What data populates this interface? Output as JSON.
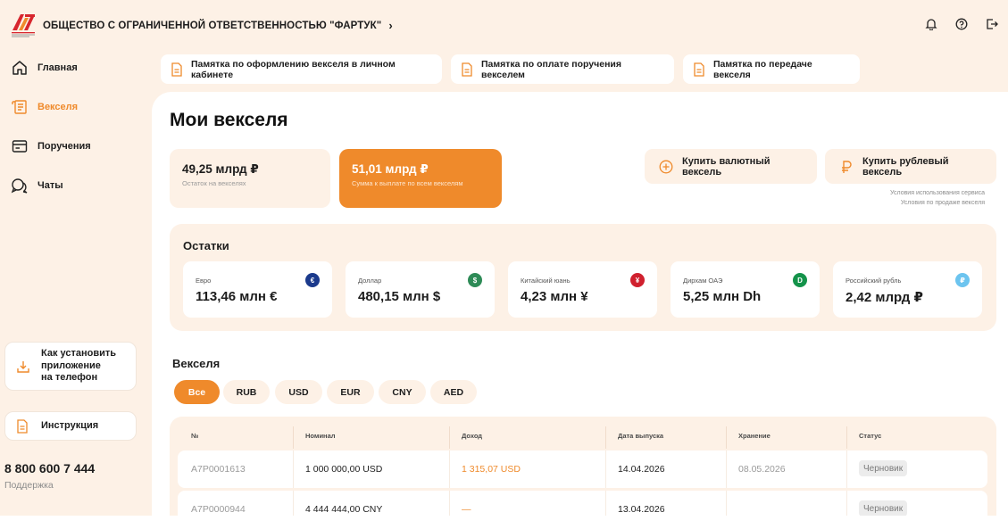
{
  "header": {
    "org_name": "ОБЩЕСТВО С ОГРАНИЧЕННОЙ ОТВЕТСТВЕННОСТЬЮ \"ФАРТУК\"",
    "icons": [
      "bell-icon",
      "help-icon",
      "logout-icon"
    ]
  },
  "sidebar": {
    "items": [
      {
        "label": "Главная",
        "icon": "home-icon",
        "active": false
      },
      {
        "label": "Векселя",
        "icon": "bills-icon",
        "active": true
      },
      {
        "label": "Поручения",
        "icon": "orders-icon",
        "active": false
      },
      {
        "label": "Чаты",
        "icon": "chat-icon",
        "active": false
      }
    ],
    "install_app": "Как установить приложение на телефон",
    "install_lines": [
      "Как установить",
      "приложение",
      "на телефон"
    ],
    "instruction": "Инструкция",
    "phone": "8 800 600 7 444",
    "support": "Поддержка"
  },
  "memos": [
    "Памятка по оформлению векселя в личном кабинете",
    "Памятка по оплате поручения векселем",
    "Памятка по передаче векселя"
  ],
  "main": {
    "title": "Мои векселя",
    "summary": [
      {
        "value": "49,25 млрд ₽",
        "label": "Остаток на векселях"
      },
      {
        "value": "51,01 млрд ₽",
        "label": "Сумма к выплате по всем векселям"
      }
    ],
    "buy_currency": "Купить валютный вексель",
    "buy_rub": "Купить рублевый вексель",
    "terms_link": "Условия использования сервиса",
    "sale_terms_link": "Условия по продаже векселя"
  },
  "balances": {
    "title": "Остатки",
    "items": [
      {
        "name": "Евро",
        "amount": "113,46 млн €",
        "symbol": "€",
        "color": "#1b3a8c"
      },
      {
        "name": "Доллар",
        "amount": "480,15 млн $",
        "symbol": "$",
        "color": "#2e8b57"
      },
      {
        "name": "Китайский юань",
        "amount": "4,23 млн ¥",
        "symbol": "¥",
        "color": "#d0202e"
      },
      {
        "name": "Дирхам ОАЭ",
        "amount": "5,25 млн Dh",
        "symbol": "D",
        "color": "#14934a"
      },
      {
        "name": "Российский рубль",
        "amount": "2,42 млрд ₽",
        "symbol": "₽",
        "color": "#6cc4ef"
      }
    ]
  },
  "bills": {
    "title": "Векселя",
    "filters": [
      "Все",
      "RUB",
      "USD",
      "EUR",
      "CNY",
      "AED"
    ],
    "active_filter": "Все",
    "columns": [
      "№",
      "Номинал",
      "Доход",
      "Дата выпуска",
      "Хранение",
      "Статус"
    ],
    "rows": [
      {
        "num": "A7P0001613",
        "nominal": "1 000 000,00 USD",
        "income": "1 315,07 USD",
        "issue_date": "14.04.2026",
        "storage": "08.05.2026",
        "status": "Черновик"
      },
      {
        "num": "A7P0000944",
        "nominal": "4 444 444,00 CNY",
        "income": "—",
        "issue_date": "13.04.2026",
        "storage": "",
        "status": "Черновик"
      }
    ]
  },
  "colors": {
    "accent": "#ef8a2b",
    "background": "#fdf1e6",
    "logo_red": "#d7262e"
  }
}
